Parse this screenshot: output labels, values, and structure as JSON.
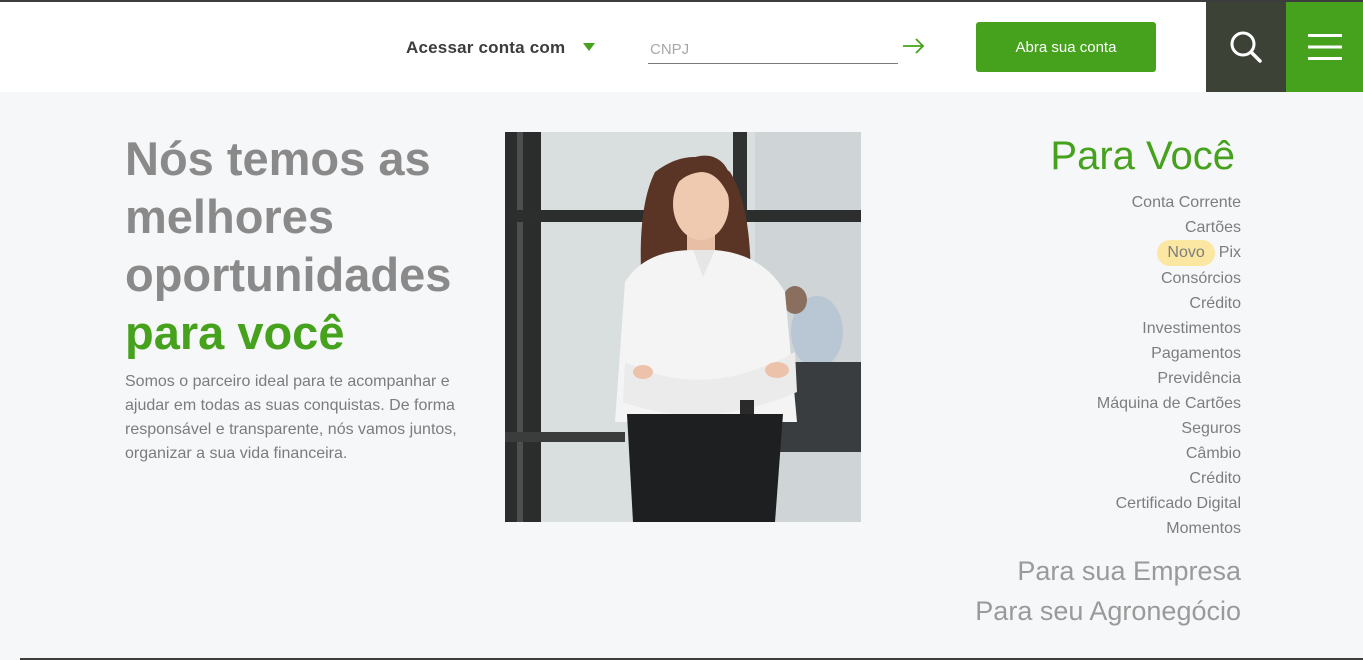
{
  "header": {
    "login_label": "Acessar conta com",
    "input_placeholder": "CNPJ",
    "input_value": "",
    "open_account_label": "Abra sua conta"
  },
  "hero": {
    "headline_gray": "Nós temos as melhores oportunidades",
    "headline_green": "para você",
    "intro": "Somos o parceiro ideal para te acompanhar e ajudar em todas as suas conquistas. De forma responsável e transparente, nós vamos juntos, organizar a sua vida financeira."
  },
  "sidebar": {
    "title": "Para Você",
    "items": [
      {
        "label": "Conta Corrente"
      },
      {
        "label": "Cartões"
      },
      {
        "label": "Pix",
        "badge": "Novo"
      },
      {
        "label": "Consórcios"
      },
      {
        "label": "Crédito"
      },
      {
        "label": "Investimentos"
      },
      {
        "label": "Pagamentos"
      },
      {
        "label": "Previdência"
      },
      {
        "label": "Máquina de Cartões"
      },
      {
        "label": "Seguros"
      },
      {
        "label": "Câmbio"
      },
      {
        "label": "Crédito"
      },
      {
        "label": "Certificado Digital"
      },
      {
        "label": "Momentos"
      }
    ],
    "business": "Para sua Empresa",
    "agro": "Para seu Agronegócio"
  },
  "icons": {
    "caret": "chevron-down-icon",
    "arrow": "arrow-right-icon",
    "search": "search-icon",
    "menu": "hamburger-menu-icon"
  },
  "colors": {
    "accent": "#46a21d",
    "dark": "#3d4237",
    "badge": "#fbe7a1",
    "background": "#f6f7f9"
  }
}
